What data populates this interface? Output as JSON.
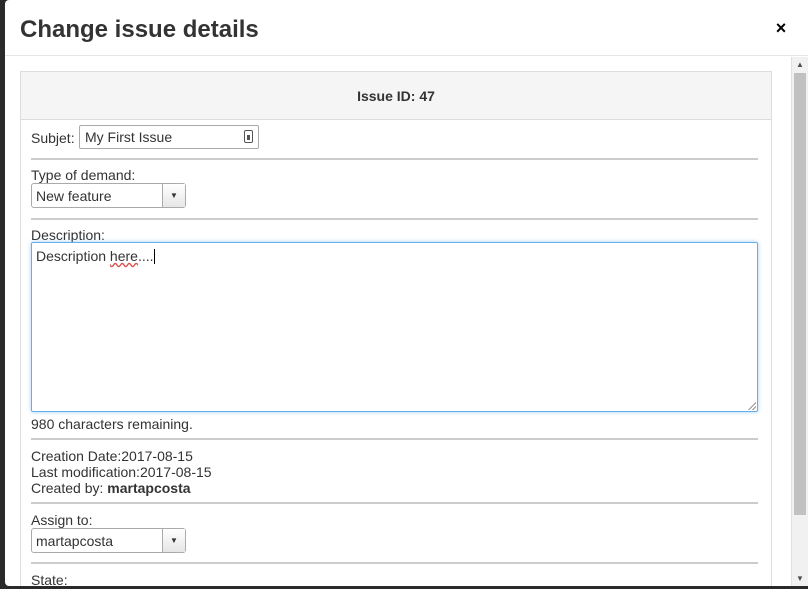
{
  "modal": {
    "title": "Change issue details",
    "close_label": "×"
  },
  "panel": {
    "heading": "Issue ID: 47"
  },
  "form": {
    "subject_label": "Subjet:",
    "subject_value": "My First Issue",
    "type_label": "Type of demand:",
    "type_value": "New feature",
    "description_label": "Description:",
    "description_prefix": "Description ",
    "description_misspelled": "here",
    "description_suffix": "....",
    "chars_remaining": "980 characters remaining.",
    "creation_date": "Creation Date:2017-08-15",
    "last_modification": "Last modification:2017-08-15",
    "created_by_label": "Created by: ",
    "created_by_value": "martapcosta",
    "assign_label": "Assign to:",
    "assign_value": "martapcosta",
    "state_label": "State:"
  },
  "icons": {
    "close": "close-icon",
    "subject_field": "contact-card-icon",
    "dropdown": "chevron-down-icon",
    "scroll_up": "scroll-up-arrow-icon",
    "scroll_down": "scroll-down-arrow-icon",
    "resize": "resize-grip-icon"
  },
  "colors": {
    "focus_border": "#66afe9",
    "panel_heading_bg": "#f5f5f5",
    "spellcheck": "#d9534f"
  }
}
